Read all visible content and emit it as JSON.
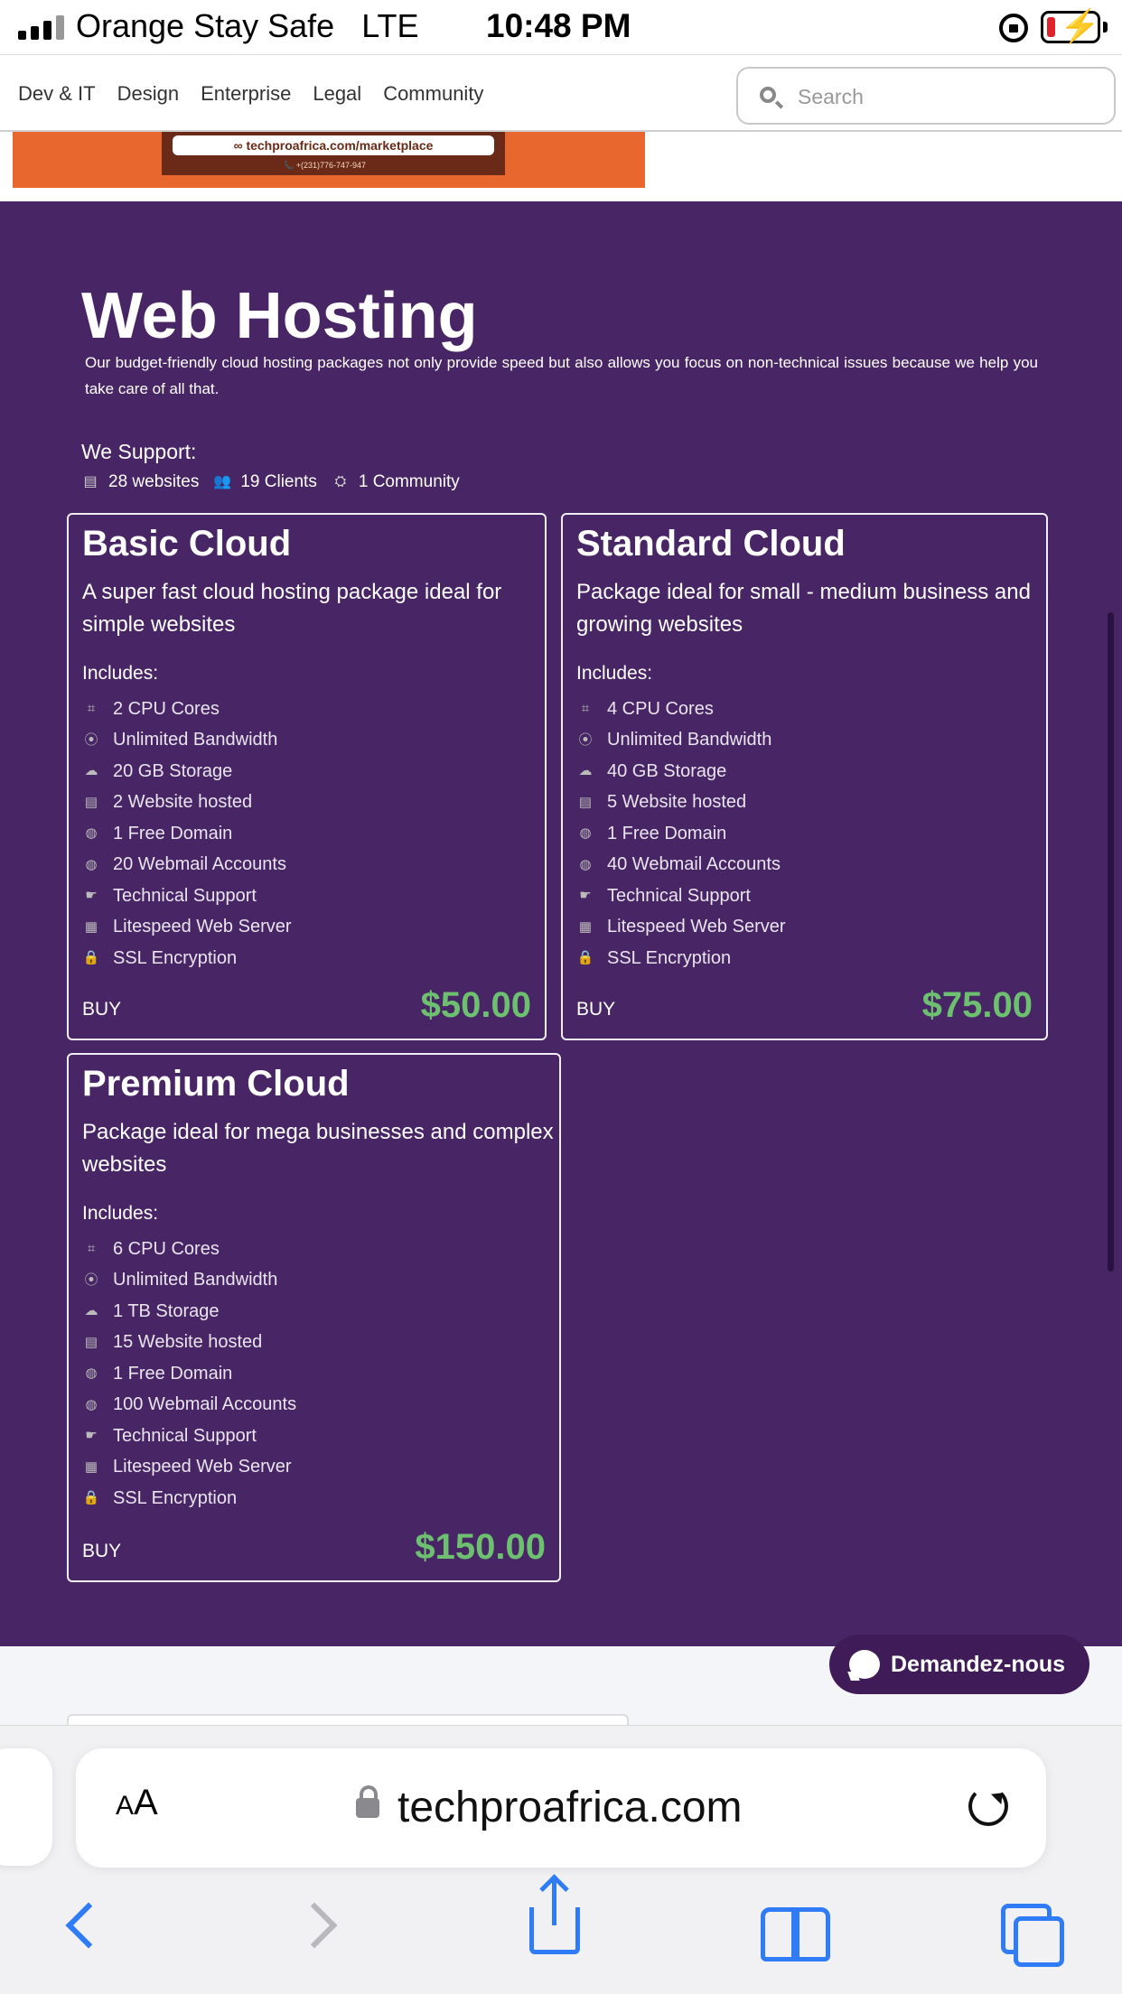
{
  "status_bar": {
    "carrier": "Orange Stay Safe",
    "network": "LTE",
    "time": "10:48 PM"
  },
  "nav": {
    "links": [
      "Dev & IT",
      "Design",
      "Enterprise",
      "Legal",
      "Community"
    ],
    "search_placeholder": "Search"
  },
  "banner": {
    "url": "techproafrica.com/marketplace",
    "phone": "+(231)776-747-947"
  },
  "hosting": {
    "title": "Web Hosting",
    "description": "Our budget-friendly cloud hosting packages not only provide speed but also allows you focus on non-technical issues because we help you take care of all that.",
    "support_label": "We Support:",
    "stats": {
      "websites": "28 websites",
      "clients": "19 Clients",
      "community": "1 Community"
    },
    "includes_label": "Includes:",
    "buy_label": "BUY",
    "plans": [
      {
        "name": "Basic Cloud",
        "description": "A super fast cloud hosting package ideal for simple websites",
        "features": [
          "2 CPU Cores",
          "Unlimited Bandwidth",
          "20 GB Storage",
          "2 Website hosted",
          "1 Free Domain",
          "20 Webmail Accounts",
          "Technical Support",
          "Litespeed Web Server",
          "SSL Encryption"
        ],
        "price": "$50.00"
      },
      {
        "name": "Standard Cloud",
        "description": "Package ideal for small - medium business and growing websites",
        "features": [
          "4 CPU Cores",
          "Unlimited Bandwidth",
          "40 GB Storage",
          "5 Website hosted",
          "1 Free Domain",
          "40 Webmail Accounts",
          "Technical Support",
          "Litespeed Web Server",
          "SSL Encryption"
        ],
        "price": "$75.00"
      },
      {
        "name": "Premium Cloud",
        "description": "Package ideal for mega businesses and complex websites",
        "features": [
          "6 CPU Cores",
          "Unlimited Bandwidth",
          "1 TB Storage",
          "15 Website hosted",
          "1 Free Domain",
          "100 Webmail Accounts",
          "Technical Support",
          "Litespeed Web Server",
          "SSL Encryption"
        ],
        "price": "$150.00"
      }
    ]
  },
  "chat": {
    "label": "Demandez-nous"
  },
  "browser": {
    "text_size_small": "A",
    "text_size_large": "A",
    "url": "techproafrica.com"
  },
  "colors": {
    "section_bg": "#482564",
    "price_green": "#6cc070",
    "ios_blue": "#2f7cf6",
    "banner_orange": "#e8672f"
  }
}
